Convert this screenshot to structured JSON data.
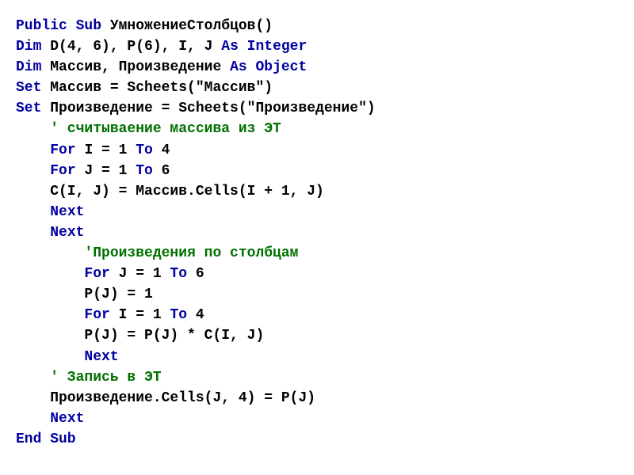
{
  "code": {
    "l1_k1": "Public Sub ",
    "l1_t1": "УмножениеСтолбцов()",
    "l2_k1": "Dim ",
    "l2_t1": "D(4, 6), P(6), I, J ",
    "l2_k2": "As Integer",
    "l3_k1": "Dim ",
    "l3_t1": "Массив, Произведение ",
    "l3_k2": "As Object",
    "l4_k1": "Set ",
    "l4_t1": "Массив = Scheets(\"Массив\")",
    "l5_k1": "Set ",
    "l5_t1": "Произведение = Scheets(\"Произведение\")",
    "l6_c": "    ' считываение массива из ЭТ",
    "l7_i": "    ",
    "l7_k1": "For ",
    "l7_t1": "I = 1 ",
    "l7_k2": "To ",
    "l7_t2": "4",
    "l8_i": "    ",
    "l8_k1": "For ",
    "l8_t1": "J = 1 ",
    "l8_k2": "To ",
    "l8_t2": "6",
    "l9_t": "    C(I, J) = Массив.Cells(I + 1, J)",
    "l10_i": "    ",
    "l10_k": "Next",
    "l11_i": "    ",
    "l11_k": "Next",
    "l12_c": "        'Произведения по столбцам",
    "l13_i": "        ",
    "l13_k1": "For ",
    "l13_t1": "J = 1 ",
    "l13_k2": "To ",
    "l13_t2": "6",
    "l14_t": "        P(J) = 1",
    "l15_i": "        ",
    "l15_k1": "For ",
    "l15_t1": "I = 1 ",
    "l15_k2": "To ",
    "l15_t2": "4",
    "l16_t": "        P(J) = P(J) * C(I, J)",
    "l17_i": "        ",
    "l17_k": "Next",
    "l18_c": "    ' Запись в ЭТ",
    "l19_t": "    Произведение.Cells(J, 4) = P(J)",
    "l20_i": "    ",
    "l20_k": "Next",
    "l21_k": "End Sub"
  }
}
